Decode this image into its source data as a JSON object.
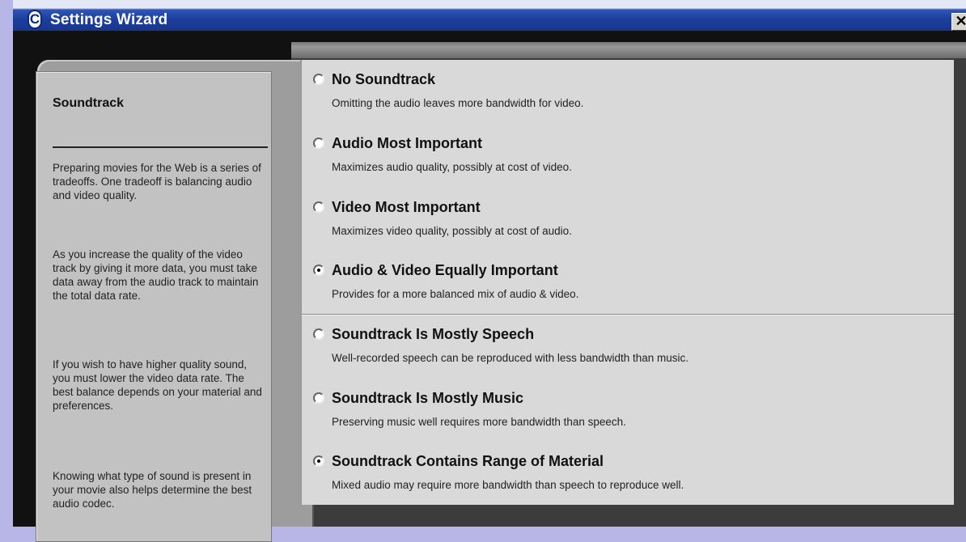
{
  "window": {
    "title": "Settings Wizard",
    "app_icon_letter": "C",
    "close_glyph": "✕"
  },
  "sidebar": {
    "title": "Soundtrack",
    "paragraphs": [
      "Preparing movies for the Web is a series of tradeoffs.  One tradeoff is balancing audio and video quality.",
      "As you increase the quality of the video track by giving it more data, you must take data away from the audio track to maintain the total data rate.",
      "If you wish to have higher quality sound, you must lower the video data rate.  The best balance depends on your material and preferences.",
      "Knowing what type of sound is present in your movie also helps determine the best audio codec."
    ]
  },
  "priority_options": [
    {
      "label": "No Soundtrack",
      "description": "Omitting the audio leaves more bandwidth for video.",
      "checked": false
    },
    {
      "label": "Audio Most Important",
      "description": "Maximizes audio quality, possibly at cost of video.",
      "checked": false
    },
    {
      "label": "Video Most Important",
      "description": "Maximizes video quality, possibly at cost of audio.",
      "checked": false
    },
    {
      "label": "Audio & Video Equally Important",
      "description": "Provides for a more balanced mix of audio & video.",
      "checked": true
    }
  ],
  "content_options": [
    {
      "label": "Soundtrack Is Mostly Speech",
      "description": "Well-recorded speech can be reproduced with less bandwidth than music.",
      "checked": false
    },
    {
      "label": "Soundtrack Is Mostly Music",
      "description": "Preserving music well requires more bandwidth than speech.",
      "checked": false
    },
    {
      "label": "Soundtrack Contains Range of Material",
      "description": "Mixed audio may require more bandwidth than speech to reproduce well.",
      "checked": true
    }
  ]
}
